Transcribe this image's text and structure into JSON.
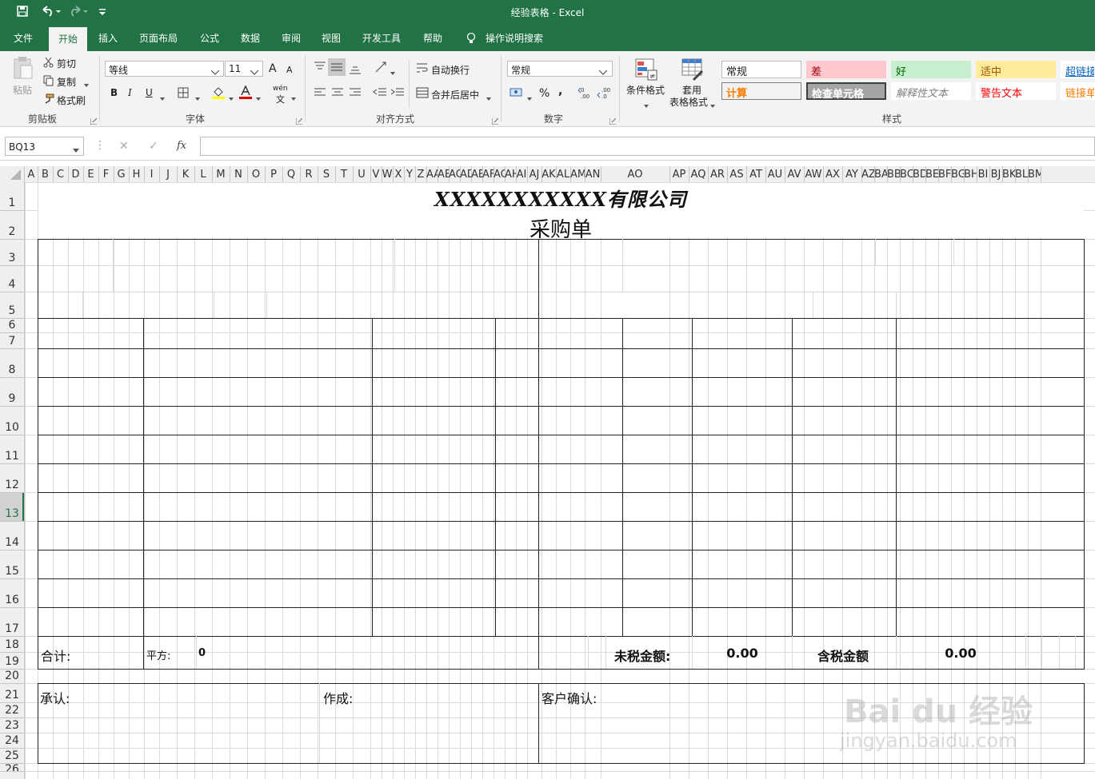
{
  "window": {
    "title": "经验表格 - Excel"
  },
  "menu_tabs": [
    "文件",
    "开始",
    "插入",
    "页面布局",
    "公式",
    "数据",
    "审阅",
    "视图",
    "开发工具",
    "帮助"
  ],
  "tell_me": "操作说明搜索",
  "clipboard": {
    "paste": "粘贴",
    "cut": "剪切",
    "copy": "复制",
    "format_painter": "格式刷",
    "group": "剪贴板"
  },
  "font": {
    "name": "等线",
    "size": "11",
    "group": "字体",
    "bold": "B",
    "italic": "I",
    "underline": "U",
    "grow": "A",
    "shrink": "A",
    "phonetic_top": "wén",
    "phonetic_bottom": "文"
  },
  "alignment": {
    "wrap": "自动换行",
    "merge": "合并后居中",
    "group": "对齐方式"
  },
  "number": {
    "format": "常规",
    "percent": "%",
    "comma": ",",
    "group": "数字"
  },
  "styles_group": {
    "conditional": "条件格式",
    "table_top": "套用",
    "table_bottom": "表格格式",
    "group": "样式"
  },
  "cell_styles": [
    {
      "label": "常规",
      "bg": "#ffffff",
      "fg": "#222222",
      "border": "#bdbdbd"
    },
    {
      "label": "差",
      "bg": "#ffc7ce",
      "fg": "#9c0006",
      "border": "#ffc7ce"
    },
    {
      "label": "好",
      "bg": "#c6efce",
      "fg": "#006100",
      "border": "#c6efce"
    },
    {
      "label": "适中",
      "bg": "#ffeb9c",
      "fg": "#9c5700",
      "border": "#ffeb9c"
    },
    {
      "label": "超链接",
      "bg": "#ffffff",
      "fg": "#0563c1",
      "border": "#ffffff"
    },
    {
      "label": "计算",
      "bg": "#f2f2f2",
      "fg": "#fa7d00",
      "border": "#7f7f7f"
    },
    {
      "label": "检查单元格",
      "bg": "#a5a5a5",
      "fg": "#ffffff",
      "border": "#3f3f3f"
    },
    {
      "label": "解释性文本",
      "bg": "#ffffff",
      "fg": "#7f7f7f",
      "border": "#ffffff"
    },
    {
      "label": "警告文本",
      "bg": "#ffffff",
      "fg": "#ff0000",
      "border": "#ffffff"
    },
    {
      "label": "链接单",
      "bg": "#ffffff",
      "fg": "#fa7d00",
      "border": "#ffffff"
    }
  ],
  "formula_bar": {
    "name_box": "BQ13",
    "cancel": "✕",
    "enter": "✓",
    "fx": "fx",
    "value": ""
  },
  "columns": [
    "A",
    "B",
    "C",
    "D",
    "E",
    "F",
    "G",
    "H",
    "I",
    "J",
    "K",
    "L",
    "M",
    "N",
    "O",
    "P",
    "Q",
    "R",
    "S",
    "T",
    "U",
    "V",
    "W",
    "X",
    "Y",
    "Z",
    "AA",
    "AB",
    "AC",
    "AD",
    "AE",
    "AF",
    "AG",
    "AH",
    "AI",
    "AJ",
    "AK",
    "AL",
    "AM",
    "AN",
    "AO",
    "AP",
    "AQ",
    "AR",
    "AS",
    "AT",
    "AU",
    "AV",
    "AW",
    "AX",
    "AY",
    "AZ",
    "BA",
    "BB",
    "BC",
    "BD",
    "BE",
    "BF",
    "BG",
    "BH",
    "BI",
    "BJ",
    "BK",
    "BL",
    "BM"
  ],
  "rows": [
    "1",
    "2",
    "3",
    "4",
    "5",
    "6",
    "7",
    "8",
    "9",
    "10",
    "11",
    "12",
    "13",
    "14",
    "15",
    "16",
    "17",
    "18",
    "19",
    "20",
    "21",
    "22",
    "23",
    "24",
    "25",
    "26"
  ],
  "sheet": {
    "company": "XXXXXXXXXXX有限公司",
    "doc_title": "采购单",
    "total_label": "合计:",
    "sqm_label": "平方:",
    "sqm_value": "0",
    "pretax_label": "未税金额:",
    "pretax_value": "0.00",
    "tax_label": "含税金额",
    "tax_value": "0.00",
    "approve": "承认:",
    "made_by": "作成:",
    "customer_confirm": "客户确认:"
  },
  "watermark": {
    "top": "Bai du 经验",
    "bottom": "jingyan.baidu.com"
  },
  "colors": {
    "excel_green": "#217346",
    "ribbon_bg": "#f3f3f3",
    "grid": "#dadada"
  }
}
